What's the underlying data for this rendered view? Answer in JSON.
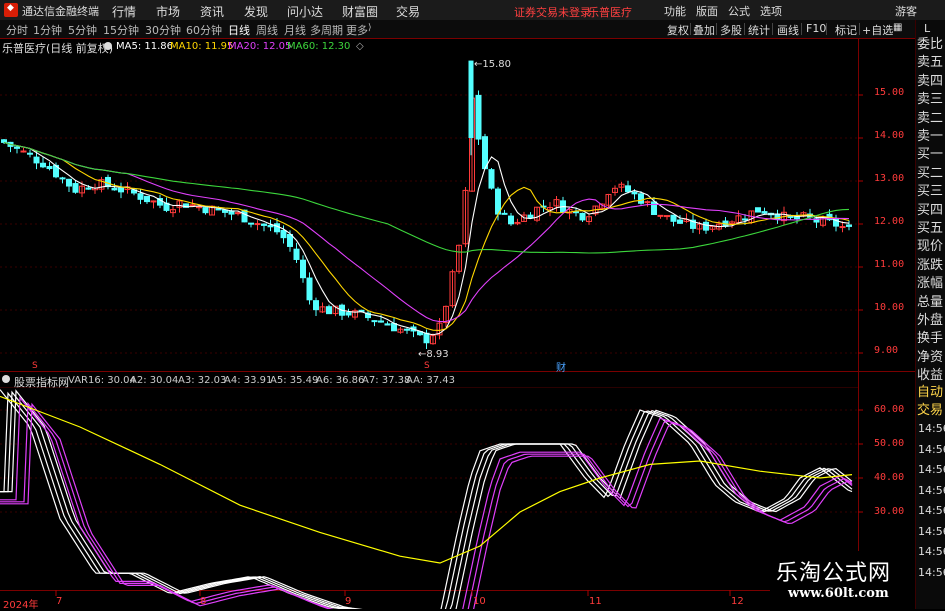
{
  "app": {
    "title": "通达信金融终端",
    "menu": [
      "行情",
      "市场",
      "资讯",
      "发现",
      "问小达",
      "财富圈",
      "交易"
    ],
    "warning": "证券交易未登录",
    "stock_title": "乐普医疗",
    "right_menu": [
      "功能",
      "版面",
      "公式",
      "选项"
    ],
    "user": "游客"
  },
  "toolbar": {
    "timeframes": [
      "分时",
      "1分钟",
      "5分钟",
      "15分钟",
      "30分钟",
      "60分钟",
      "日线",
      "周线",
      "月线",
      "多周期",
      "更多"
    ],
    "active": "日线",
    "buttons": [
      "复权",
      "叠加",
      "多股",
      "统计",
      "画线",
      "F10",
      "标记",
      "+自选"
    ]
  },
  "right_panel": {
    "items": [
      "委比",
      "卖五",
      "卖四",
      "卖三",
      "卖二",
      "卖一",
      "买一",
      "买二",
      "买三",
      "买四",
      "买五",
      "现价",
      "涨跌",
      "涨幅",
      "总量",
      "外盘",
      "换手",
      "净资",
      "收益"
    ],
    "lower": [
      "自动",
      "交易"
    ],
    "times": [
      "14:56",
      "14:56",
      "14:56",
      "14:56",
      "14:56",
      "14:56",
      "14:56",
      "14:56"
    ]
  },
  "main_chart": {
    "name": "乐普医疗(日线 前复权)",
    "ma": [
      {
        "label": "MA5: 11.86",
        "color": "#ffffff"
      },
      {
        "label": "MA10: 11.95",
        "color": "#ffd700"
      },
      {
        "label": "MA20: 12.05",
        "color": "#e040fb"
      },
      {
        "label": "MA60: 12.30",
        "color": "#3cd63c"
      }
    ],
    "high_label": "15.80",
    "low_label": "8.93",
    "y_ticks": [
      "15.00",
      "14.00",
      "13.00",
      "12.00",
      "11.00",
      "10.00",
      "9.00"
    ],
    "marker": "财"
  },
  "indicator": {
    "name": "股票指标网",
    "values": [
      {
        "label": "VAR16: 30.04",
        "color": "#ffffff"
      },
      {
        "label": "A2: 30.04",
        "color": "#ffffff"
      },
      {
        "label": "A3: 32.03",
        "color": "#ffffff"
      },
      {
        "label": "A4: 33.91",
        "color": "#ffffff"
      },
      {
        "label": "A5: 35.49",
        "color": "#e040fb"
      },
      {
        "label": "A6: 36.86",
        "color": "#e040fb"
      },
      {
        "label": "A7: 37.38",
        "color": "#e040fb"
      },
      {
        "label": "AA: 37.43",
        "color": "#ffff00"
      }
    ],
    "y_ticks": [
      "60.00",
      "50.00",
      "40.00",
      "30.00"
    ]
  },
  "x_axis": {
    "labels": [
      "2024年",
      "7",
      "8",
      "9",
      "10",
      "11",
      "12"
    ]
  },
  "watermark": {
    "line1": "乐淘公式网",
    "line2": "www.60lt.com"
  }
}
